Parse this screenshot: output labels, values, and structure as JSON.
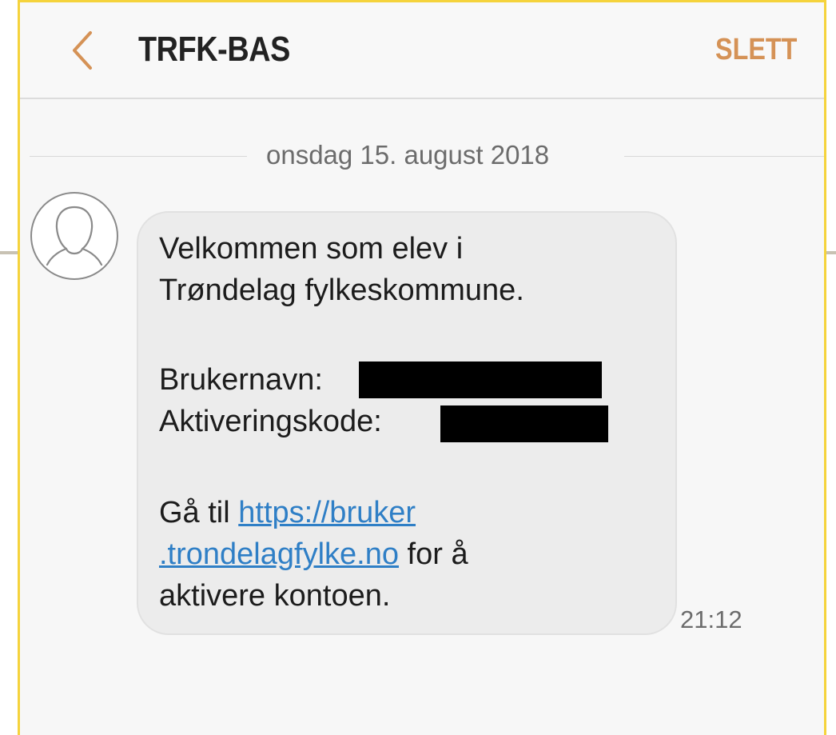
{
  "header": {
    "title": "TRFK-BAS",
    "delete_label": "SLETT",
    "accent_color": "#d59256"
  },
  "thread": {
    "date_separator": "onsdag 15. august 2018"
  },
  "message": {
    "line1": "Velkommen som elev i",
    "line2": "Trøndelag fylkeskommune.",
    "username_label": "Brukernavn:",
    "code_label": "Aktiveringskode:",
    "goto_prefix": "Gå til ",
    "link_part1": "https://bruker",
    "link_part2": ".trondelagfylke.no",
    "goto_suffix": " for å",
    "line_last": "aktivere kontoen.",
    "time": "21:12",
    "link_color": "#2f7fc6"
  },
  "icons": {
    "back": "chevron-left-icon",
    "avatar": "person-outline-icon"
  }
}
